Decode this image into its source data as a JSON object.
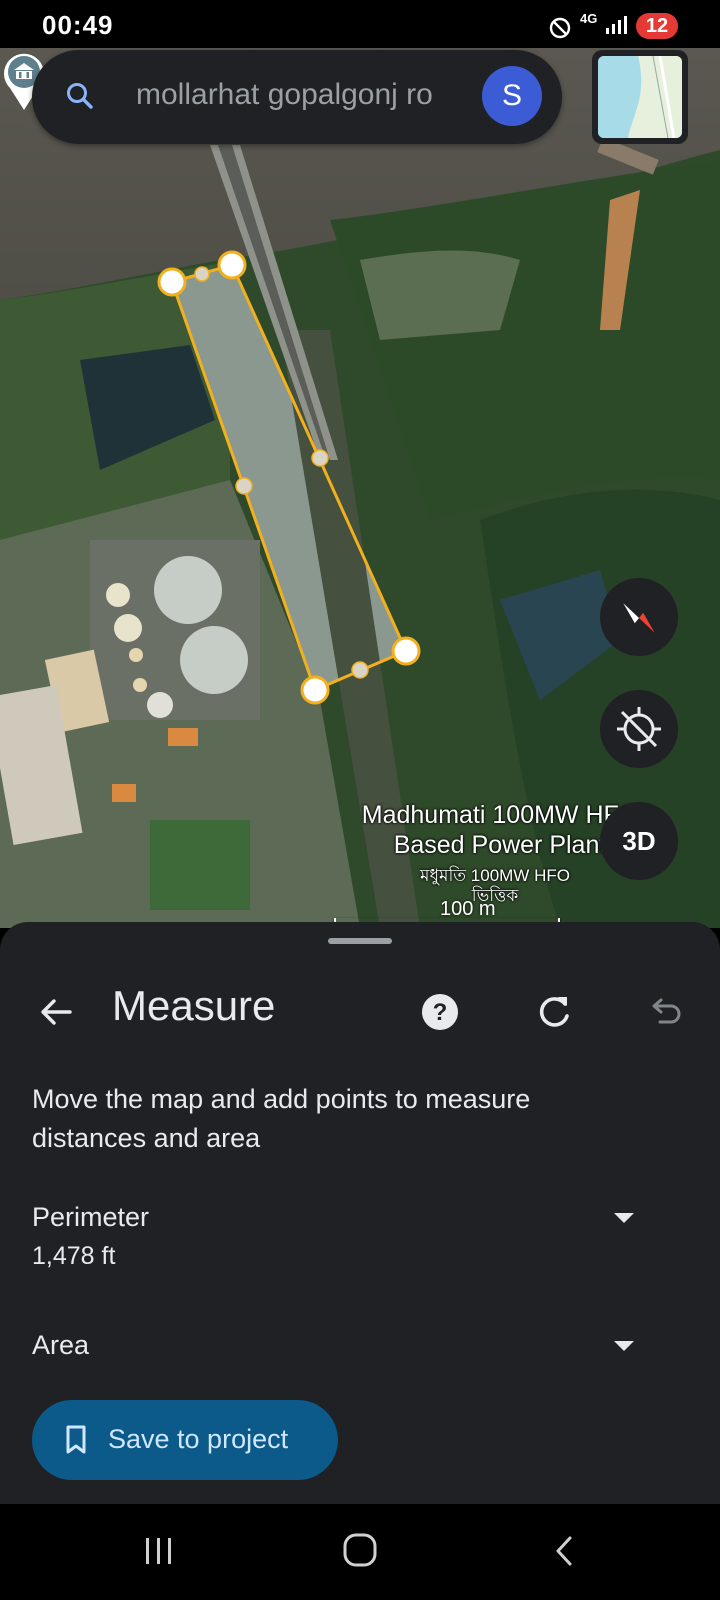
{
  "status_bar": {
    "time": "00:49",
    "network": "4G",
    "battery_badge": "12",
    "icons": [
      "do-not-disturb-icon",
      "signal-icon"
    ]
  },
  "search": {
    "text": "mollarhat gopalgonj ro",
    "avatar_letter": "S",
    "icon": "search-icon"
  },
  "map": {
    "place_name_en": "Madhumati 100MW HFO Based Power Plant",
    "place_name_bn": "মধুমতি 100MW HFO ভিত্তিক",
    "scale_label": "100 m",
    "three_d_label": "3D",
    "measure_color": "#f2b01e"
  },
  "sheet": {
    "title": "Measure",
    "instructions": "Move the map and add points to measure distances and area",
    "perimeter_label": "Perimeter",
    "perimeter_value": "1,478 ft",
    "area_label": "Area",
    "save_label": "Save to project"
  },
  "colors": {
    "sheet_bg": "#202124",
    "save_button": "#0b5a8a",
    "avatar": "#3c5cd6",
    "badge": "#e53935"
  }
}
